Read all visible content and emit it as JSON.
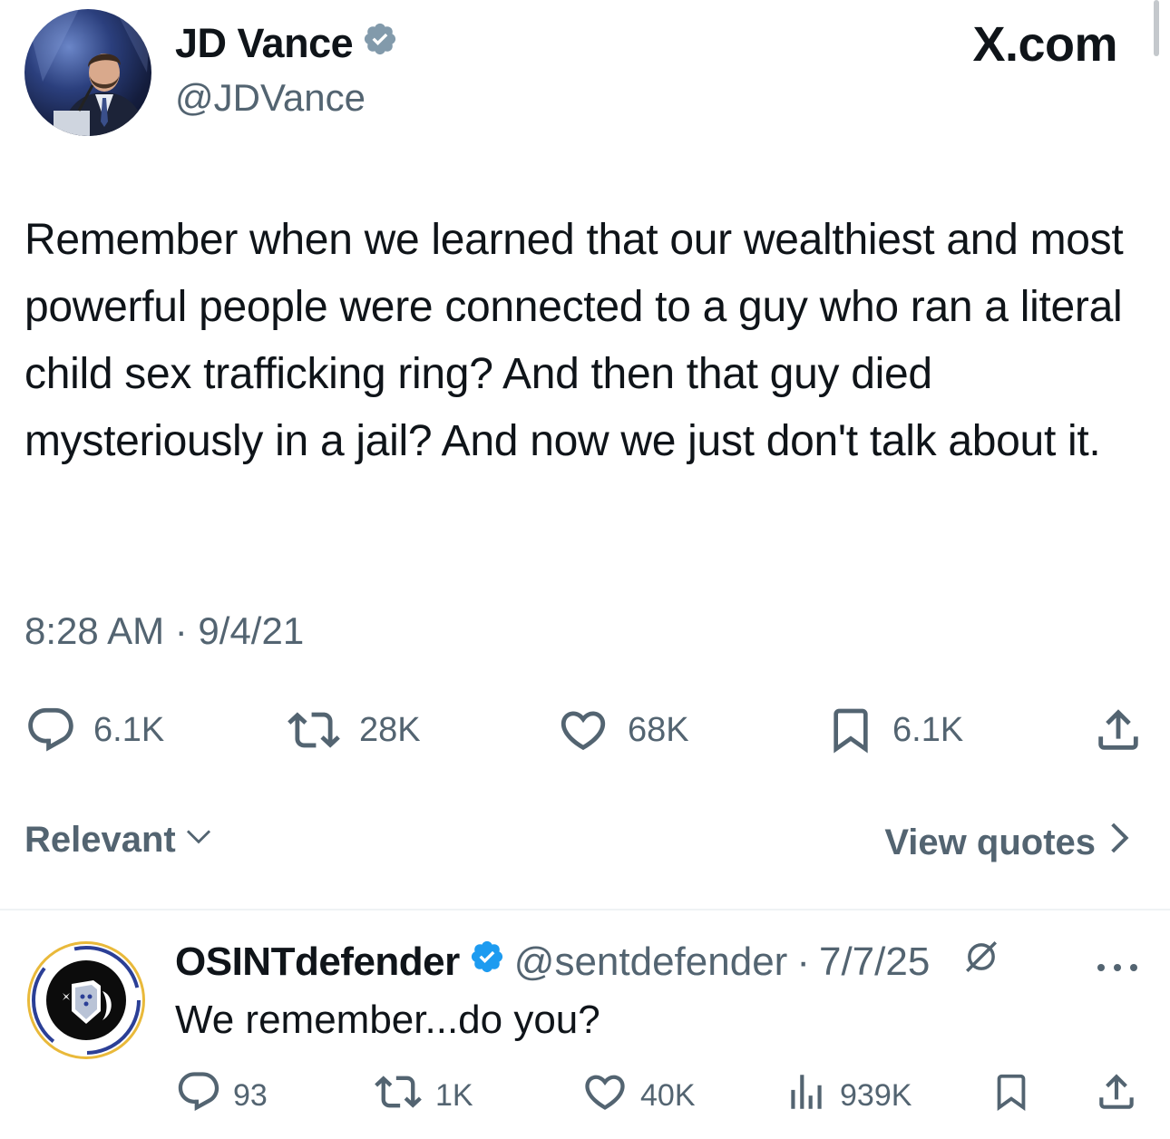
{
  "header": {
    "display_name": "JD Vance",
    "handle": "@JDVance",
    "brand": "X.com",
    "verified_icon": "verified-badge-icon"
  },
  "tweet": {
    "text": "Remember when we learned that our wealthiest and most powerful people were connected to a guy who ran a literal child sex trafficking ring? And then that guy died mysteriously in a jail? And now we just don't talk about it.",
    "timestamp": "8:28 AM · 9/4/21",
    "stats": {
      "replies": "6.1K",
      "reposts": "28K",
      "likes": "68K",
      "bookmarks": "6.1K"
    }
  },
  "filters": {
    "sort_label": "Relevant",
    "view_quotes_label": "View quotes"
  },
  "reply": {
    "display_name": "OSINTdefender",
    "handle": "@sentdefender",
    "separator": "·",
    "date": "7/7/25",
    "text": "We remember...do you?",
    "stats": {
      "replies": "93",
      "reposts": "1K",
      "likes": "40K",
      "views": "939K"
    }
  },
  "colors": {
    "text_primary": "#0f1419",
    "text_secondary": "#536471",
    "verified_gray": "#829aab",
    "verified_blue": "#1d9bf0",
    "divider": "#eff3f4"
  }
}
